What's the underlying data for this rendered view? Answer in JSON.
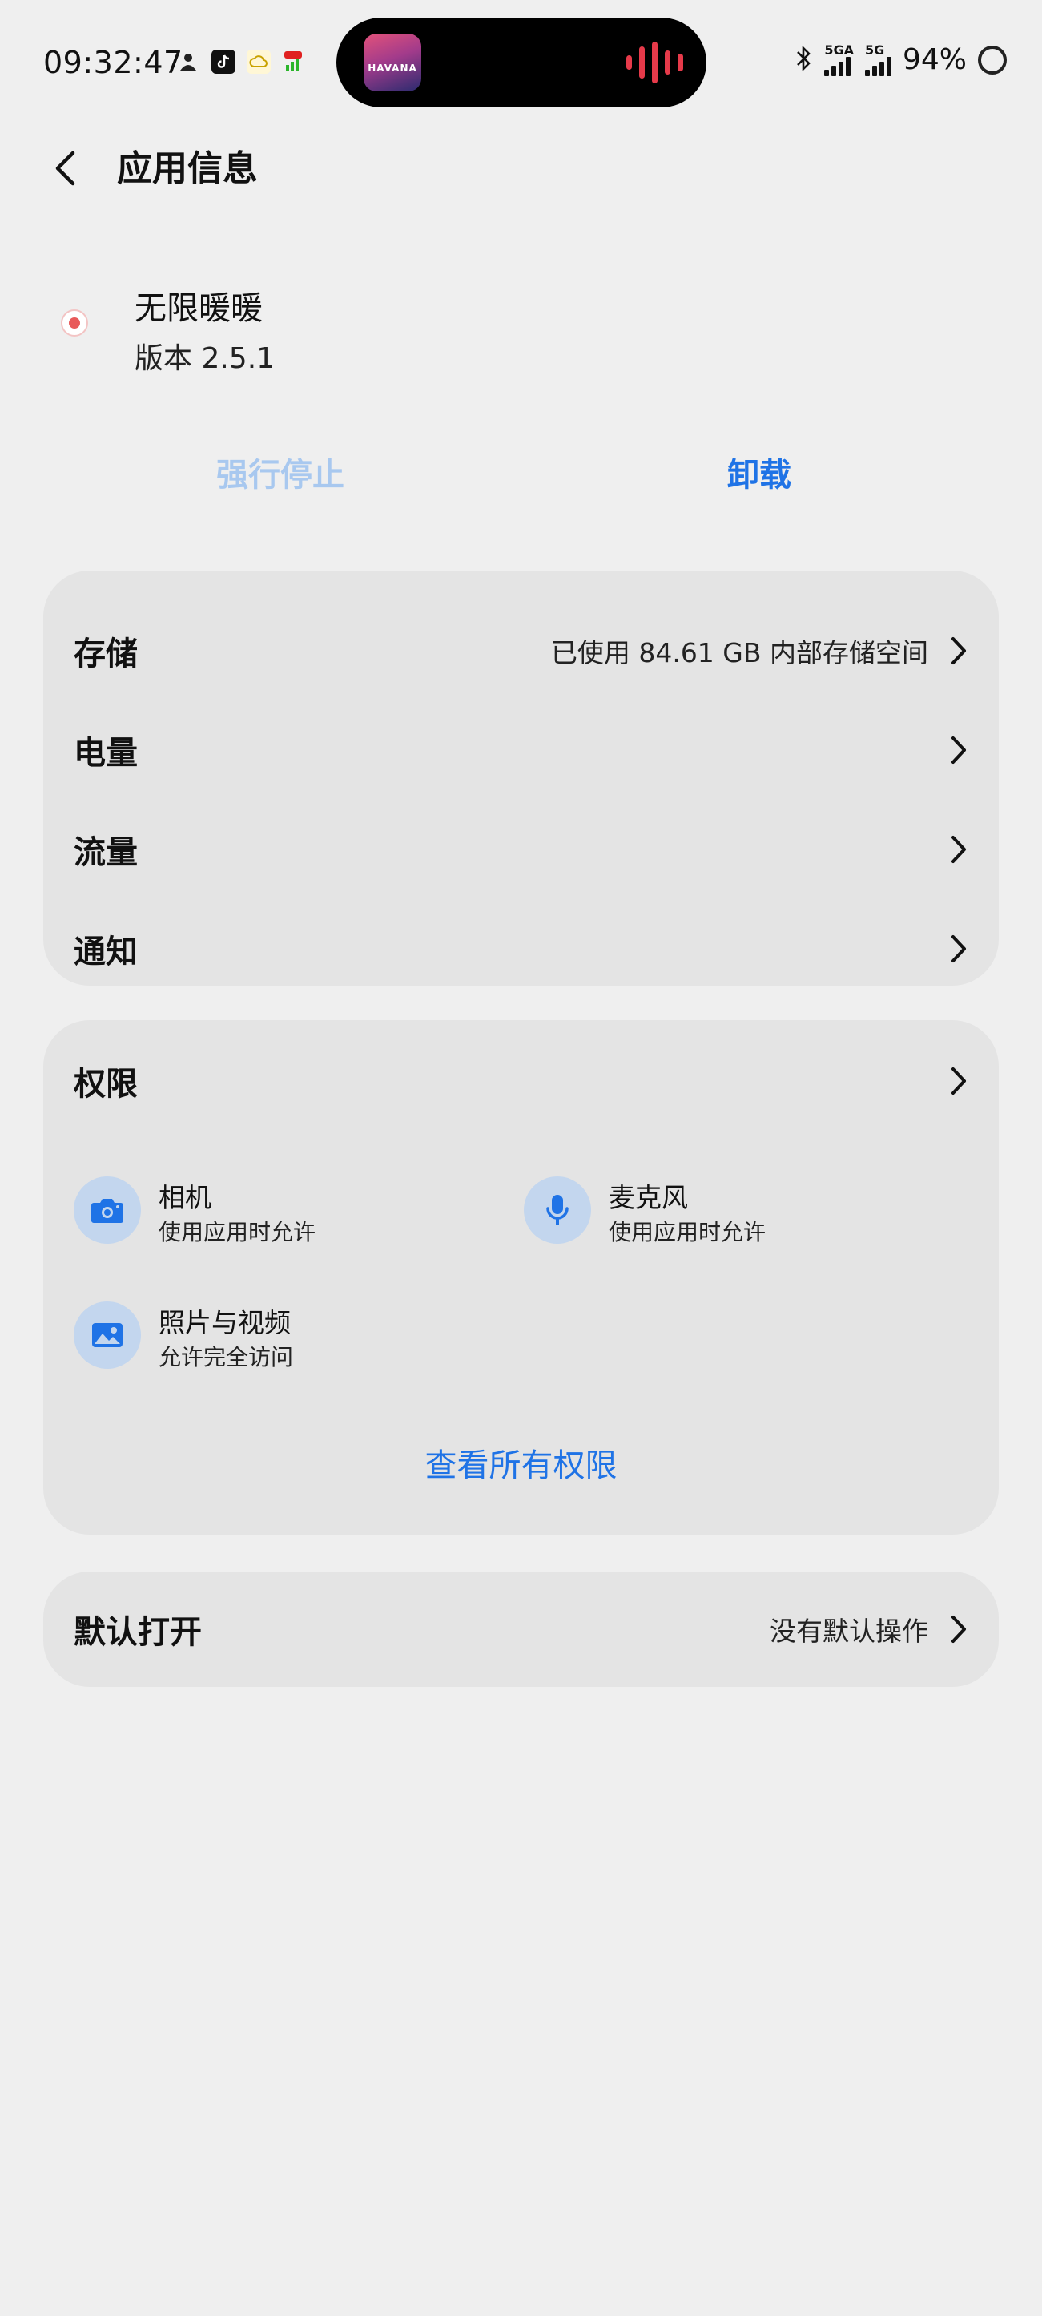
{
  "status_bar": {
    "time": "09:32:47",
    "notification_icons": [
      "person-icon",
      "tiktok-icon",
      "cloud-icon",
      "signal-pro-icon"
    ],
    "now_playing": {
      "album_text": "HAVANA",
      "wave_color": "#e63a4a"
    },
    "net1": "5GA",
    "net2": "5G",
    "battery": "94%"
  },
  "header": {
    "title": "应用信息",
    "back_icon": "chevron-left-icon"
  },
  "app": {
    "name": "无限暖暖",
    "version": "版本 2.5.1"
  },
  "actions": {
    "force_stop": "强行停止",
    "uninstall": "卸载"
  },
  "usage_items": [
    {
      "label": "存储",
      "value": "已使用 84.61 GB 内部存储空间"
    },
    {
      "label": "电量",
      "value": ""
    },
    {
      "label": "流量",
      "value": ""
    },
    {
      "label": "通知",
      "value": ""
    }
  ],
  "permissions": {
    "title": "权限",
    "items": [
      {
        "name": "相机",
        "desc": "使用应用时允许",
        "icon": "camera-icon"
      },
      {
        "name": "麦克风",
        "desc": "使用应用时允许",
        "icon": "microphone-icon"
      },
      {
        "name": "照片与视频",
        "desc": "允许完全访问",
        "icon": "photo-icon"
      }
    ],
    "view_all": "查看所有权限"
  },
  "default_open": {
    "label": "默认打开",
    "value": "没有默认操作"
  },
  "colors": {
    "accent": "#1f73e6",
    "disabled_accent": "#a8c8ef",
    "card_bg": "#e4e4e4",
    "page_bg": "#efefef",
    "icon_circle": "#c3d6ee"
  }
}
